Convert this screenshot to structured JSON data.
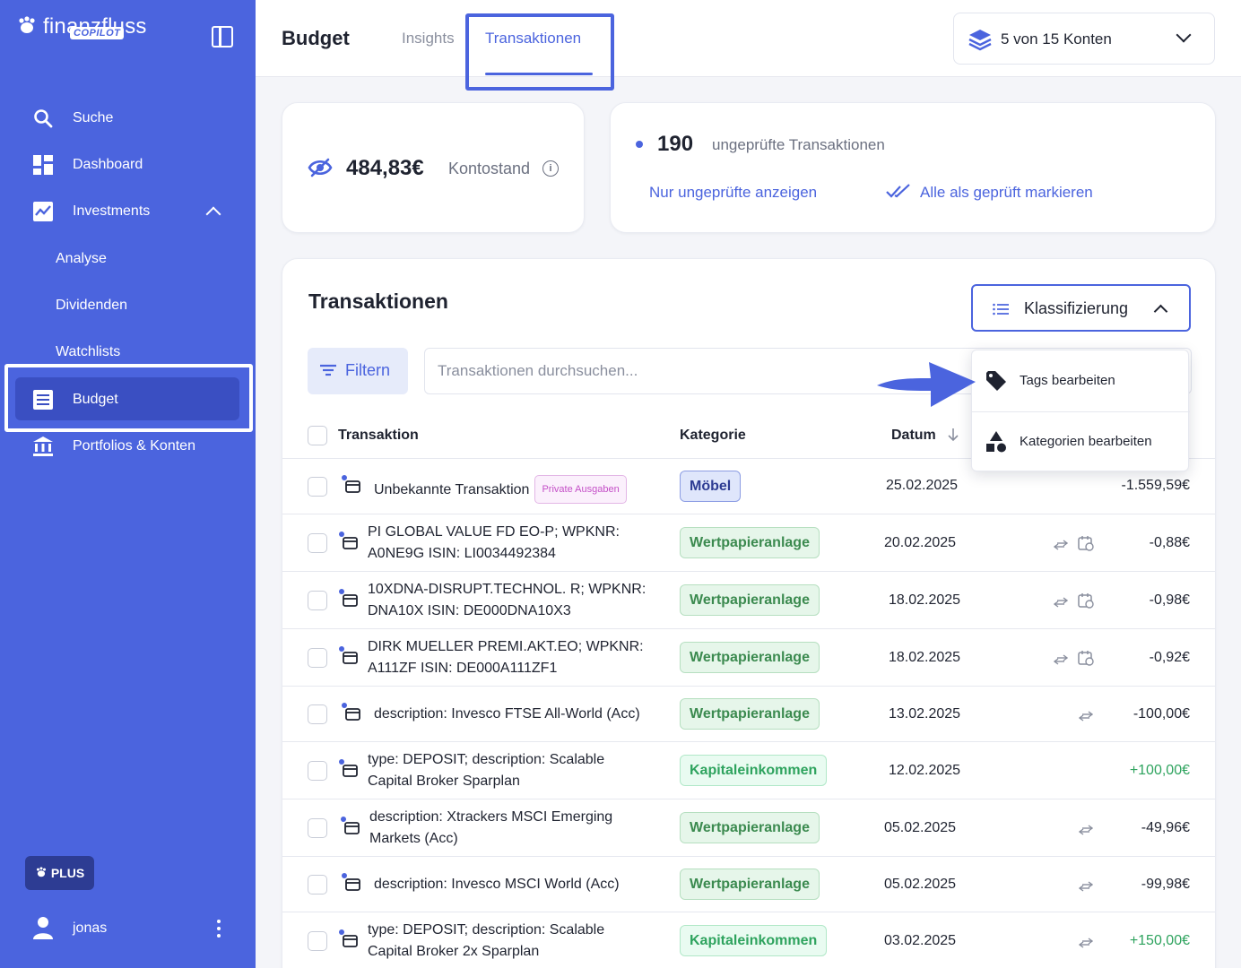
{
  "app": {
    "name": "finanzfluss",
    "badge": "COPILOT"
  },
  "sidebar": {
    "items": [
      {
        "label": "Suche",
        "icon": "search-icon"
      },
      {
        "label": "Dashboard",
        "icon": "dashboard-icon"
      },
      {
        "label": "Investments",
        "icon": "chart-icon",
        "expanded": true
      },
      {
        "label": "Analyse"
      },
      {
        "label": "Dividenden"
      },
      {
        "label": "Watchlists"
      },
      {
        "label": "Budget",
        "icon": "budget-icon",
        "active": true
      },
      {
        "label": "Portfolios & Konten",
        "icon": "bank-icon"
      }
    ],
    "plus_label": "PLUS",
    "user_name": "jonas"
  },
  "header": {
    "title": "Budget",
    "tabs": [
      {
        "label": "Insights",
        "active": false
      },
      {
        "label": "Transaktionen",
        "active": true
      }
    ],
    "accounts_label": "5 von 15 Konten"
  },
  "balance": {
    "amount": "484,83€",
    "label": "Kontostand"
  },
  "unchecked": {
    "count": "190",
    "label": "ungeprüfte Transaktionen",
    "show_only": "Nur ungeprüfte anzeigen",
    "mark_all": "Alle als geprüft markieren"
  },
  "transactions": {
    "title": "Transaktionen",
    "classification_label": "Klassifizierung",
    "filter_label": "Filtern",
    "search_placeholder": "Transaktionen durchsuchen...",
    "columns": {
      "transaction": "Transaktion",
      "category": "Kategorie",
      "date": "Datum"
    },
    "menu": [
      {
        "label": "Tags bearbeiten",
        "icon": "tag-icon"
      },
      {
        "label": "Kategorien bearbeiten",
        "icon": "shapes-icon"
      }
    ],
    "rows": [
      {
        "line1": "Unbekannte Transaktion",
        "line2": "",
        "tag": "Private Ausgaben",
        "category": "Möbel",
        "date": "25.02.2025",
        "amount": "-1.559,59€"
      },
      {
        "line1": "PI GLOBAL VALUE FD EO-P; WPKNR:",
        "line2": "A0NE9G ISIN: LI0034492384",
        "category": "Wertpapieranlage",
        "date": "20.02.2025",
        "amount": "-0,88€"
      },
      {
        "line1": "10XDNA-DISRUPT.TECHNOL. R; WPKNR:",
        "line2": "DNA10X ISIN: DE000DNA10X3",
        "category": "Wertpapieranlage",
        "date": "18.02.2025",
        "amount": "-0,98€"
      },
      {
        "line1": "DIRK MUELLER PREMI.AKT.EO; WPKNR:",
        "line2": "A111ZF ISIN: DE000A111ZF1",
        "category": "Wertpapieranlage",
        "date": "18.02.2025",
        "amount": "-0,92€"
      },
      {
        "line1": "description: Invesco FTSE All-World (Acc)",
        "line2": "",
        "category": "Wertpapieranlage",
        "date": "13.02.2025",
        "amount": "-100,00€"
      },
      {
        "line1": "type: DEPOSIT; description: Scalable",
        "line2": "Capital Broker Sparplan",
        "category": "Kapitaleinkommen",
        "date": "12.02.2025",
        "amount": "+100,00€"
      },
      {
        "line1": "description: Xtrackers MSCI Emerging",
        "line2": "Markets (Acc)",
        "category": "Wertpapieranlage",
        "date": "05.02.2025",
        "amount": "-49,96€"
      },
      {
        "line1": "description: Invesco MSCI World (Acc)",
        "line2": "",
        "category": "Wertpapieranlage",
        "date": "05.02.2025",
        "amount": "-99,98€"
      },
      {
        "line1": "type: DEPOSIT; description: Scalable",
        "line2": "Capital Broker 2x Sparplan",
        "category": "Kapitaleinkommen",
        "date": "03.02.2025",
        "amount": "+150,00€"
      }
    ]
  },
  "colors": {
    "brand": "#4b64de",
    "positive": "#2ea35e",
    "tag": "#c44fc7"
  }
}
